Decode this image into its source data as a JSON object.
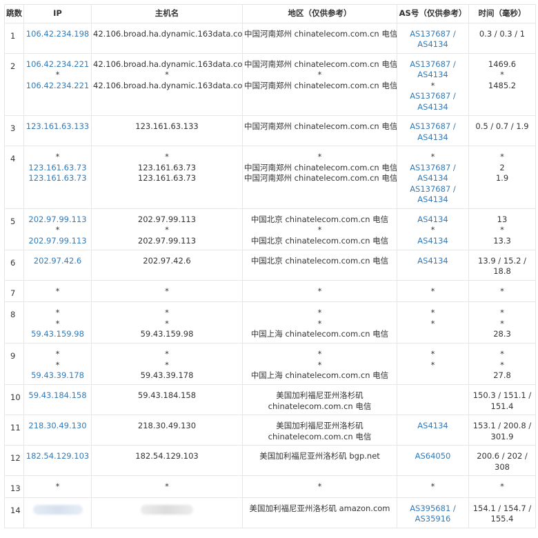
{
  "columns": {
    "hop": "跳数",
    "ip": "IP",
    "host": "主机名",
    "region": "地区（仅供参考）",
    "as": "AS号（仅供参考）",
    "time": "时间（毫秒）"
  },
  "rows": [
    {
      "hop": "1",
      "ip": [
        "106.42.234.198"
      ],
      "host": [
        "42.106.broad.ha.dynamic.163data.com.cn"
      ],
      "region": [
        "中国河南郑州 chinatelecom.com.cn 电信"
      ],
      "as": [
        "AS137687 /",
        "AS4134"
      ],
      "time": [
        "0.3 / 0.3 / 1"
      ]
    },
    {
      "hop": "2",
      "ip": [
        "106.42.234.221",
        "*",
        "106.42.234.221"
      ],
      "host": [
        "42.106.broad.ha.dynamic.163data.com.cn",
        "*",
        "42.106.broad.ha.dynamic.163data.com.cn"
      ],
      "region": [
        "中国河南郑州 chinatelecom.com.cn 电信",
        "*",
        "中国河南郑州 chinatelecom.com.cn 电信"
      ],
      "as": [
        "AS137687 /",
        "AS4134",
        "*",
        "AS137687 /",
        "AS4134"
      ],
      "time": [
        "1469.6",
        "*",
        "1485.2"
      ]
    },
    {
      "hop": "3",
      "ip": [
        "123.161.63.133"
      ],
      "host": [
        "123.161.63.133"
      ],
      "region": [
        "中国河南郑州 chinatelecom.com.cn 电信"
      ],
      "as": [
        "AS137687 /",
        "AS4134"
      ],
      "time": [
        "0.5 / 0.7 / 1.9"
      ]
    },
    {
      "hop": "4",
      "ip": [
        "*",
        "123.161.63.73",
        "123.161.63.73"
      ],
      "host": [
        "*",
        "123.161.63.73",
        "123.161.63.73"
      ],
      "region": [
        "*",
        "中国河南郑州 chinatelecom.com.cn 电信",
        "中国河南郑州 chinatelecom.com.cn 电信"
      ],
      "as": [
        "*",
        "AS137687 /",
        "AS4134",
        "AS137687 /",
        "AS4134"
      ],
      "time": [
        "*",
        "2",
        "1.9"
      ]
    },
    {
      "hop": "5",
      "ip": [
        "202.97.99.113",
        "*",
        "202.97.99.113"
      ],
      "host": [
        "202.97.99.113",
        "*",
        "202.97.99.113"
      ],
      "region": [
        "中国北京 chinatelecom.com.cn 电信",
        "*",
        "中国北京 chinatelecom.com.cn 电信"
      ],
      "as": [
        "AS4134",
        "*",
        "AS4134"
      ],
      "time": [
        "13",
        "*",
        "13.3"
      ]
    },
    {
      "hop": "6",
      "ip": [
        "202.97.42.6"
      ],
      "host": [
        "202.97.42.6"
      ],
      "region": [
        "中国北京 chinatelecom.com.cn 电信"
      ],
      "as": [
        "AS4134"
      ],
      "time": [
        "13.9 / 15.2 /",
        "18.8"
      ]
    },
    {
      "hop": "7",
      "ip": [
        "*"
      ],
      "host": [
        "*"
      ],
      "region": [
        "*"
      ],
      "as": [
        "*"
      ],
      "time": [
        "*"
      ]
    },
    {
      "hop": "8",
      "ip": [
        "*",
        "*",
        "59.43.159.98"
      ],
      "host": [
        "*",
        "*",
        "59.43.159.98"
      ],
      "region": [
        "*",
        "*",
        "中国上海 chinatelecom.com.cn 电信"
      ],
      "as": [
        "*",
        "*"
      ],
      "time": [
        "*",
        "*",
        "28.3"
      ]
    },
    {
      "hop": "9",
      "ip": [
        "*",
        "*",
        "59.43.39.178"
      ],
      "host": [
        "*",
        "*",
        "59.43.39.178"
      ],
      "region": [
        "*",
        "*",
        "中国上海 chinatelecom.com.cn 电信"
      ],
      "as": [
        "*",
        "*"
      ],
      "time": [
        "*",
        "*",
        "27.8"
      ]
    },
    {
      "hop": "10",
      "ip": [
        "59.43.184.158"
      ],
      "host": [
        "59.43.184.158"
      ],
      "region": [
        "美国加利福尼亚州洛杉矶",
        "chinatelecom.com.cn 电信"
      ],
      "as": [],
      "time": [
        "150.3 / 151.1 /",
        "151.4"
      ]
    },
    {
      "hop": "11",
      "ip": [
        "218.30.49.130"
      ],
      "host": [
        "218.30.49.130"
      ],
      "region": [
        "美国加利福尼亚州洛杉矶",
        "chinatelecom.com.cn 电信"
      ],
      "as": [
        "AS4134"
      ],
      "time": [
        "153.1 / 200.8 /",
        "301.9"
      ]
    },
    {
      "hop": "12",
      "ip": [
        "182.54.129.103"
      ],
      "host": [
        "182.54.129.103"
      ],
      "region": [
        "美国加利福尼亚州洛杉矶 bgp.net"
      ],
      "as": [
        "AS64050"
      ],
      "time": [
        "200.6 / 202 /",
        "308"
      ]
    },
    {
      "hop": "13",
      "ip": [
        "*"
      ],
      "host": [
        "*"
      ],
      "region": [
        "*"
      ],
      "as": [
        "*"
      ],
      "time": [
        "*"
      ]
    },
    {
      "hop": "14",
      "ip": [],
      "host": [],
      "region": [
        "美国加利福尼亚州洛杉矶 amazon.com"
      ],
      "as": [
        "AS395681 /",
        "AS35916"
      ],
      "time": [
        "154.1 / 154.7 /",
        "155.4"
      ]
    }
  ],
  "colors": {
    "link": "#337ab7",
    "text": "#333333",
    "border": "#e6e6e6"
  }
}
